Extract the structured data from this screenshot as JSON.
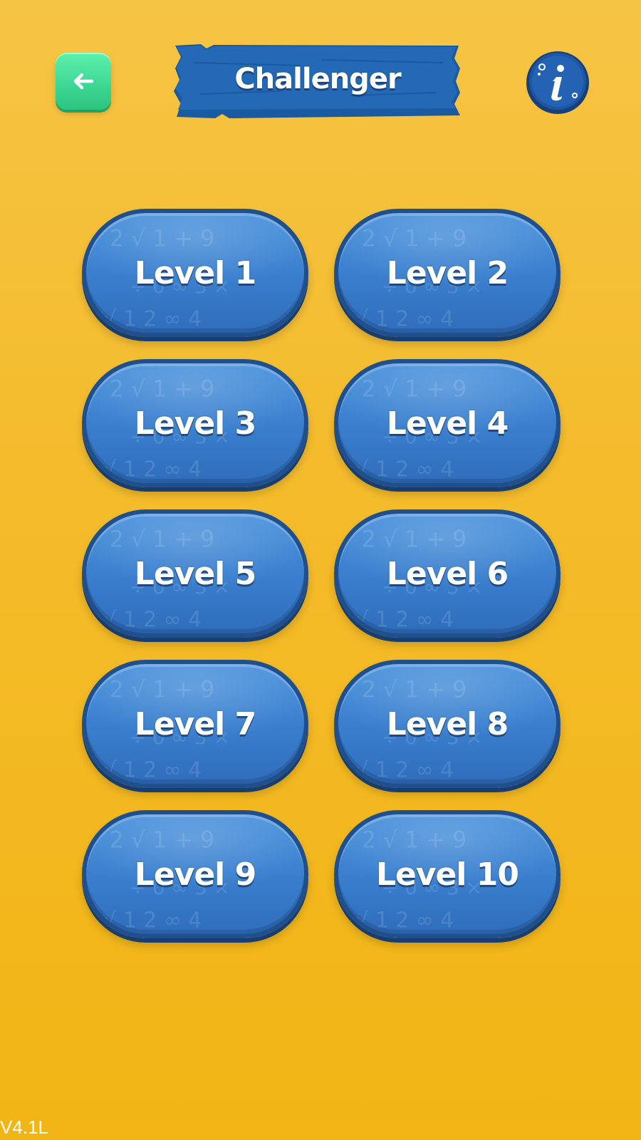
{
  "header": {
    "back_icon": "arrow-left-icon",
    "title": "Challenger",
    "info_icon": "info-icon"
  },
  "levels": [
    {
      "label": "Level 1"
    },
    {
      "label": "Level 2"
    },
    {
      "label": "Level 3"
    },
    {
      "label": "Level 4"
    },
    {
      "label": "Level 5"
    },
    {
      "label": "Level 6"
    },
    {
      "label": "Level 7"
    },
    {
      "label": "Level 8"
    },
    {
      "label": "Level 9"
    },
    {
      "label": "Level 10"
    }
  ],
  "footer": {
    "version": "V4.1L"
  },
  "colors": {
    "background": "#f4bb2a",
    "back_button": "#3ed995",
    "level_button": "#3a80cf",
    "level_border": "#1f4f8d",
    "banner": "#1f65b0",
    "info_button": "#1e4f96"
  }
}
